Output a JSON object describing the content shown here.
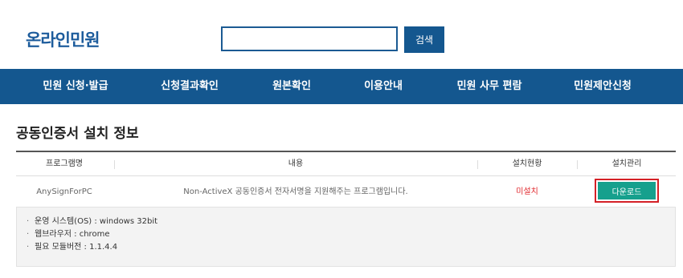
{
  "header": {
    "logo": "온라인민원",
    "search_placeholder": "",
    "search_button": "검색"
  },
  "nav": [
    {
      "label": "민원 신청·발급"
    },
    {
      "label": "신청결과확인"
    },
    {
      "label": "원본확인"
    },
    {
      "label": "이용안내"
    },
    {
      "label": "민원 사무 편람"
    },
    {
      "label": "민원제안신청"
    }
  ],
  "page": {
    "title": "공동인증서 설치 정보"
  },
  "table": {
    "headers": [
      "프로그램명",
      "내용",
      "설치현황",
      "설치관리"
    ],
    "rows": [
      {
        "program": "AnySignForPC",
        "description": "Non-ActiveX 공동인증서 전자서명을 지원해주는 프로그램입니다.",
        "status": "미설치",
        "action": "다운로드"
      }
    ]
  },
  "info": [
    "운영 시스템(OS) : windows 32bit",
    "웹브라우저 : chrome",
    "필요 모듈버전 : 1.1.4.4"
  ],
  "colors": {
    "primary": "#14578f",
    "download": "#16a08d",
    "status_red": "#e0262b",
    "highlight_border": "#d42026"
  }
}
